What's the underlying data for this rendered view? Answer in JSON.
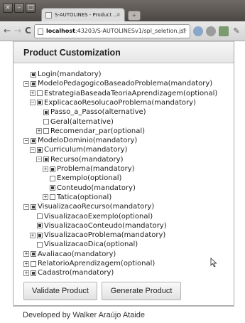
{
  "browser": {
    "window_buttons": [
      "×",
      "–",
      "□"
    ],
    "tab_title": "S-AUTOLINES - Product ...",
    "tab_close": "×",
    "new_tab": "+",
    "url_host": "localhost",
    "url_rest": ":43203/S-AUTOLINESv1/spl_seletion.jsf",
    "back": "←",
    "forward": "→",
    "reload": "C"
  },
  "panel": {
    "title": "Product Customization"
  },
  "tree": [
    {
      "label": "Login(mandatory)",
      "depth": 0,
      "expander": "none",
      "checked": true
    },
    {
      "label": "ModeloPedagogicoBaseadoProblema(mandatory)",
      "depth": 0,
      "expander": "minus",
      "checked": true
    },
    {
      "label": "EstrategiaBaseadaTeoriaAprendizagem(optional)",
      "depth": 1,
      "expander": "plus",
      "checked": false
    },
    {
      "label": "ExplicacaoResolucaoProblema(mandatory)",
      "depth": 1,
      "expander": "minus",
      "checked": true
    },
    {
      "label": "Passo_a_Passo(alternative)",
      "depth": 2,
      "expander": "none",
      "checked": true
    },
    {
      "label": "Geral(alternative)",
      "depth": 2,
      "expander": "none",
      "checked": false
    },
    {
      "label": "Recomendar_par(optional)",
      "depth": 2,
      "expander": "plus",
      "checked": false
    },
    {
      "label": "ModeloDominio(mandatory)",
      "depth": 0,
      "expander": "minus",
      "checked": true
    },
    {
      "label": "Curriculum(mandatory)",
      "depth": 1,
      "expander": "minus",
      "checked": true
    },
    {
      "label": "Recurso(mandatory)",
      "depth": 2,
      "expander": "minus",
      "checked": true
    },
    {
      "label": "Problema(mandatory)",
      "depth": 3,
      "expander": "plus",
      "checked": true
    },
    {
      "label": "Exemplo(optional)",
      "depth": 3,
      "expander": "none",
      "checked": false
    },
    {
      "label": "Conteudo(mandatory)",
      "depth": 3,
      "expander": "none",
      "checked": true
    },
    {
      "label": "Tatica(optional)",
      "depth": 3,
      "expander": "plus",
      "checked": false
    },
    {
      "label": "VisualizacaoRecurso(mandatory)",
      "depth": 0,
      "expander": "minus",
      "checked": true
    },
    {
      "label": "VisualizacaoExemplo(optional)",
      "depth": 1,
      "expander": "none",
      "checked": false
    },
    {
      "label": "VisualizacaoConteudo(mandatory)",
      "depth": 1,
      "expander": "none",
      "checked": true
    },
    {
      "label": "VisualizacaoProblema(mandatory)",
      "depth": 1,
      "expander": "plus",
      "checked": true
    },
    {
      "label": "VisualizacaoDica(optional)",
      "depth": 1,
      "expander": "none",
      "checked": false
    },
    {
      "label": "Avaliacao(mandatory)",
      "depth": 0,
      "expander": "plus",
      "checked": true
    },
    {
      "label": "RelatorioAprendizagem(optional)",
      "depth": 0,
      "expander": "plus",
      "checked": false
    },
    {
      "label": "Cadastro(mandatory)",
      "depth": 0,
      "expander": "plus",
      "checked": true
    }
  ],
  "actions": {
    "validate_label": "Validate Product",
    "generate_label": "Generate Product"
  },
  "footer": {
    "text": "Developed by Walker Araújo Ataide"
  }
}
